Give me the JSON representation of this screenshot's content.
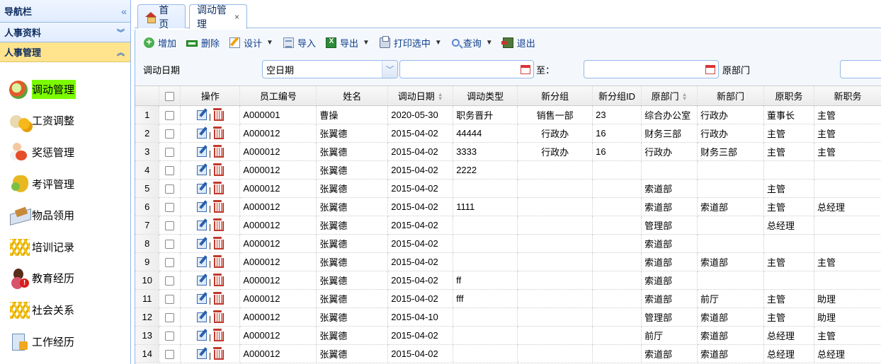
{
  "sidebar": {
    "title": "导航栏",
    "sections": [
      {
        "label": "人事资料",
        "state": "collapsed"
      },
      {
        "label": "人事管理",
        "state": "expanded"
      }
    ],
    "items": [
      {
        "label": "调动管理",
        "icon": "transfer-icon",
        "selected": true
      },
      {
        "label": "工资调整",
        "icon": "salary-icon"
      },
      {
        "label": "奖惩管理",
        "icon": "reward-icon"
      },
      {
        "label": "考评管理",
        "icon": "evaluation-icon"
      },
      {
        "label": "物品领用",
        "icon": "goods-icon"
      },
      {
        "label": "培训记录",
        "icon": "training-icon"
      },
      {
        "label": "教育经历",
        "icon": "education-icon"
      },
      {
        "label": "社会关系",
        "icon": "social-icon"
      },
      {
        "label": "工作经历",
        "icon": "work-icon"
      }
    ]
  },
  "tabs": [
    {
      "label": "首页",
      "icon": "home-icon"
    },
    {
      "label": "调动管理",
      "closable": true,
      "active": true
    }
  ],
  "toolbar": {
    "add": "增加",
    "delete": "删除",
    "design": "设计",
    "import": "导入",
    "export": "导出",
    "print": "打印选中",
    "query": "查询",
    "exit": "退出"
  },
  "filter": {
    "date_label": "调动日期",
    "date_mode": "空日期",
    "to_label": "至：",
    "from_date": "",
    "to_date": "",
    "dept_label": "原部门",
    "dept_value": ""
  },
  "grid": {
    "columns": [
      "操作",
      "员工编号",
      "姓名",
      "调动日期",
      "调动类型",
      "新分组",
      "新分组ID",
      "原部门",
      "新部门",
      "原职务",
      "新职务"
    ],
    "rows": [
      [
        "1",
        "A000001",
        "曹操",
        "2020-05-30",
        "职务晋升",
        "销售一部",
        "23",
        "综合办公室",
        "行政办",
        "董事长",
        "主管"
      ],
      [
        "2",
        "A000012",
        "张翼德",
        "2015-04-02",
        "44444",
        "行政办",
        "16",
        "财务三部",
        "行政办",
        "主管",
        "主管"
      ],
      [
        "3",
        "A000012",
        "张翼德",
        "2015-04-02",
        "3333",
        "行政办",
        "16",
        "行政办",
        "财务三部",
        "主管",
        "主管"
      ],
      [
        "4",
        "A000012",
        "张翼德",
        "2015-04-02",
        "2222",
        "",
        "",
        "",
        "",
        "",
        ""
      ],
      [
        "5",
        "A000012",
        "张翼德",
        "2015-04-02",
        "",
        "",
        "",
        "索道部",
        "",
        "主管",
        ""
      ],
      [
        "6",
        "A000012",
        "张翼德",
        "2015-04-02",
        "1111",
        "",
        "",
        "索道部",
        "索道部",
        "主管",
        "总经理"
      ],
      [
        "7",
        "A000012",
        "张翼德",
        "2015-04-02",
        "",
        "",
        "",
        "管理部",
        "",
        "总经理",
        ""
      ],
      [
        "8",
        "A000012",
        "张翼德",
        "2015-04-02",
        "",
        "",
        "",
        "索道部",
        "",
        "",
        ""
      ],
      [
        "9",
        "A000012",
        "张翼德",
        "2015-04-02",
        "",
        "",
        "",
        "索道部",
        "索道部",
        "主管",
        "主管"
      ],
      [
        "10",
        "A000012",
        "张翼德",
        "2015-04-02",
        "ff",
        "",
        "",
        "索道部",
        "",
        "",
        ""
      ],
      [
        "11",
        "A000012",
        "张翼德",
        "2015-04-02",
        "fff",
        "",
        "",
        "索道部",
        "前厅",
        "主管",
        "助理"
      ],
      [
        "12",
        "A000012",
        "张翼德",
        "2015-04-10",
        "",
        "",
        "",
        "管理部",
        "索道部",
        "主管",
        "助理"
      ],
      [
        "13",
        "A000012",
        "张翼德",
        "2015-04-02",
        "",
        "",
        "",
        "前厅",
        "索道部",
        "总经理",
        "主管"
      ],
      [
        "14",
        "A000012",
        "张翼德",
        "2015-04-02",
        "",
        "",
        "",
        "索道部",
        "索道部",
        "总经理",
        "总经理"
      ]
    ]
  }
}
